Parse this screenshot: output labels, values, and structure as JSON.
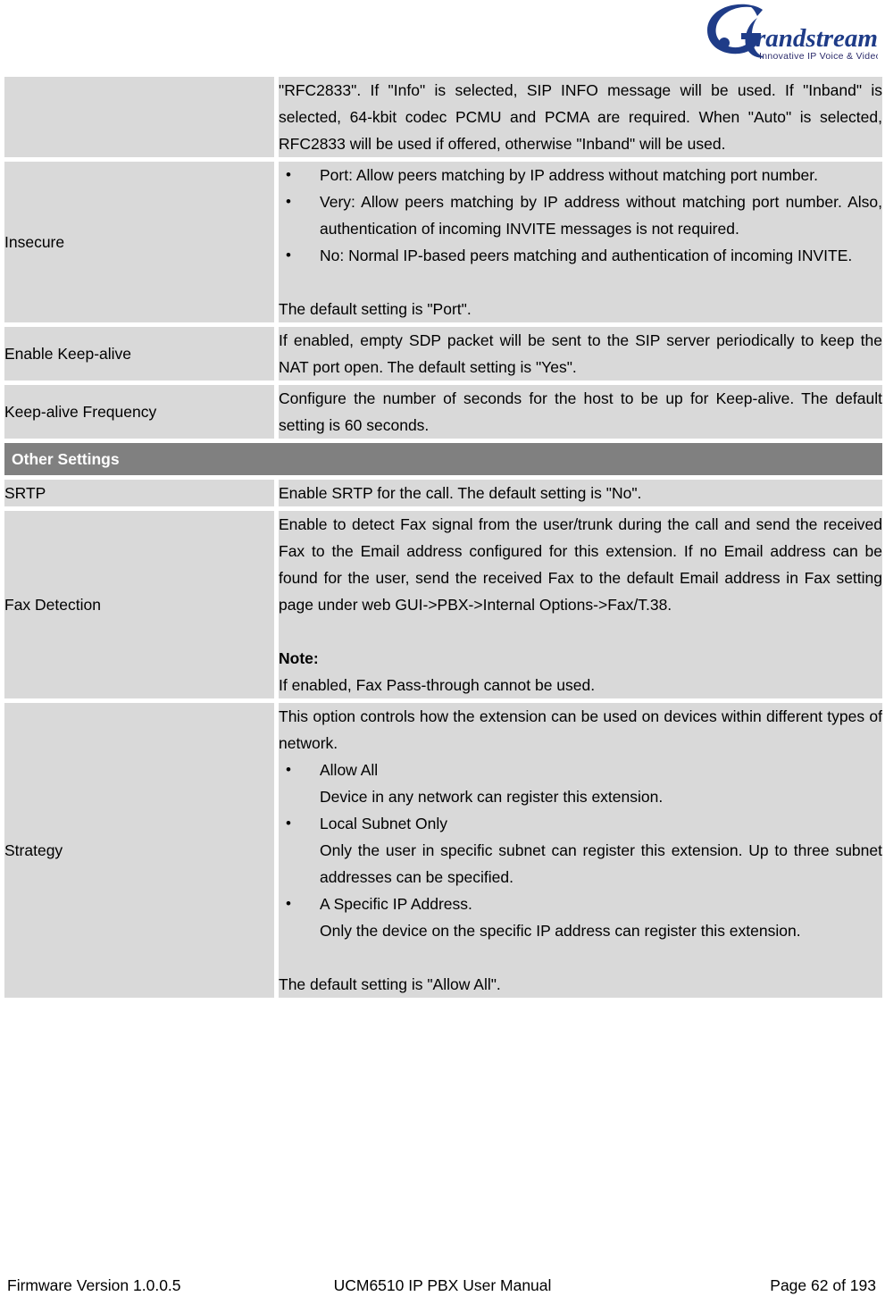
{
  "header": {
    "logo_name": "Grandstream",
    "logo_tagline": "Innovative IP Voice & Video"
  },
  "table": {
    "rows": [
      {
        "id": "dtmf-mode-continued",
        "label": "",
        "paragraphs": [
          "\"RFC2833\". If \"Info\" is selected, SIP INFO message will be used. If \"Inband\" is selected, 64-kbit codec PCMU and PCMA are required. When \"Auto\" is selected, RFC2833 will be used if offered, otherwise \"Inband\" will be used."
        ]
      },
      {
        "id": "insecure",
        "label": "Insecure",
        "bullets": [
          "Port: Allow peers matching by IP address without matching port number.",
          "Very: Allow peers matching by IP address without matching port number. Also, authentication of incoming INVITE messages is not required.",
          "No: Normal IP-based peers matching and authentication of incoming INVITE."
        ],
        "footer_text": "The default setting is \"Port\"."
      },
      {
        "id": "enable-keep-alive",
        "label": "Enable Keep-alive",
        "paragraphs": [
          "If enabled, empty SDP packet will be sent to the SIP server periodically to keep the NAT port open. The default setting is \"Yes\"."
        ]
      },
      {
        "id": "keep-alive-frequency",
        "label": "Keep-alive Frequency",
        "paragraphs": [
          "Configure the number of seconds for the host to be up for Keep-alive. The default setting is 60 seconds."
        ]
      }
    ],
    "section_header": "Other Settings",
    "rows2": [
      {
        "id": "srtp",
        "label": "SRTP",
        "paragraphs": [
          "Enable SRTP for the call. The default setting is \"No\"."
        ]
      },
      {
        "id": "fax-detection",
        "label": "Fax Detection",
        "paragraphs": [
          "Enable to detect Fax signal from the user/trunk during the call and send the received Fax to the Email address configured for this extension. If no Email address can be found for the user, send the received Fax to the default Email address in Fax setting page under web GUI->PBX->Internal Options->Fax/T.38."
        ],
        "note_label": "Note:",
        "note_text": "If enabled, Fax Pass-through cannot be used."
      },
      {
        "id": "strategy",
        "label": "Strategy",
        "intro": "This option controls how the extension can be used on devices within different types of network.",
        "bullet_groups": [
          {
            "title": "Allow All",
            "body": "Device in any network can register this extension."
          },
          {
            "title": "Local Subnet Only",
            "body": "Only the user in specific subnet can register this extension. Up to three subnet addresses can be specified."
          },
          {
            "title": "A Specific IP Address.",
            "body": "Only the device on the specific IP address can register this extension."
          }
        ],
        "footer_text": "The default setting is \"Allow All\"."
      }
    ]
  },
  "footer": {
    "left": "Firmware Version 1.0.0.5",
    "center": "UCM6510 IP PBX User Manual",
    "right": "Page 62 of 193"
  },
  "colors": {
    "cell_bg": "#d9d9d9",
    "section_bg": "#808080",
    "logo_blue": "#1f3c88",
    "page_bg": "#ffffff"
  }
}
